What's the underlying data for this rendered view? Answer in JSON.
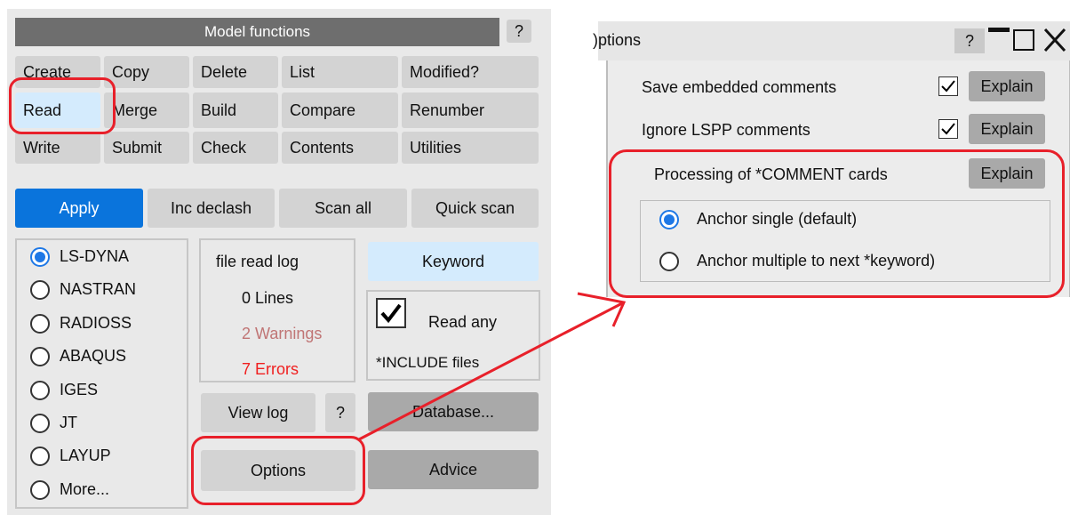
{
  "model_functions": {
    "title": "Model functions",
    "help_label": "?",
    "grid": [
      [
        "Create",
        "Copy",
        "Delete",
        "List",
        "Modified?"
      ],
      [
        "Read",
        "Merge",
        "Build",
        "Compare",
        "Renumber"
      ],
      [
        "Write",
        "Submit",
        "Check",
        "Contents",
        "Utilities"
      ]
    ],
    "apply_label": "Apply",
    "inc_declash_label": "Inc declash",
    "scan_all_label": "Scan all",
    "quick_scan_label": "Quick scan",
    "formats": [
      "LS-DYNA",
      "NASTRAN",
      "RADIOSS",
      "ABAQUS",
      "IGES",
      "JT",
      "LAYUP",
      "More..."
    ],
    "selected_format": "LS-DYNA",
    "log": {
      "title": "file read log",
      "lines": "0 Lines",
      "warnings": "2 Warnings",
      "errors": "7 Errors"
    },
    "keyword_label": "Keyword",
    "read_any_label": "Read any",
    "include_files_label": "*INCLUDE files",
    "read_any_checked": true,
    "view_log_label": "View log",
    "view_log_help": "?",
    "database_label": "Database...",
    "options_label": "Options",
    "advice_label": "Advice"
  },
  "options_window": {
    "title": "Options",
    "title_visible": ")ptions",
    "help_label": "?",
    "save_embedded_label": "Save embedded comments",
    "save_embedded_checked": true,
    "ignore_lspp_label": "Ignore LSPP comments",
    "ignore_lspp_checked": true,
    "processing_label": "Processing of *COMMENT cards",
    "explain_label": "Explain",
    "anchor_single_label": "Anchor single (default)",
    "anchor_multiple_label": "Anchor multiple to next *keyword)",
    "selected_anchor": "Anchor single (default)"
  },
  "colors": {
    "highlight": "#e8202a",
    "apply_blue": "#0a74dc",
    "radio_blue": "#1e78e6",
    "warning_text": "#c07575",
    "error_text": "#f02020"
  }
}
